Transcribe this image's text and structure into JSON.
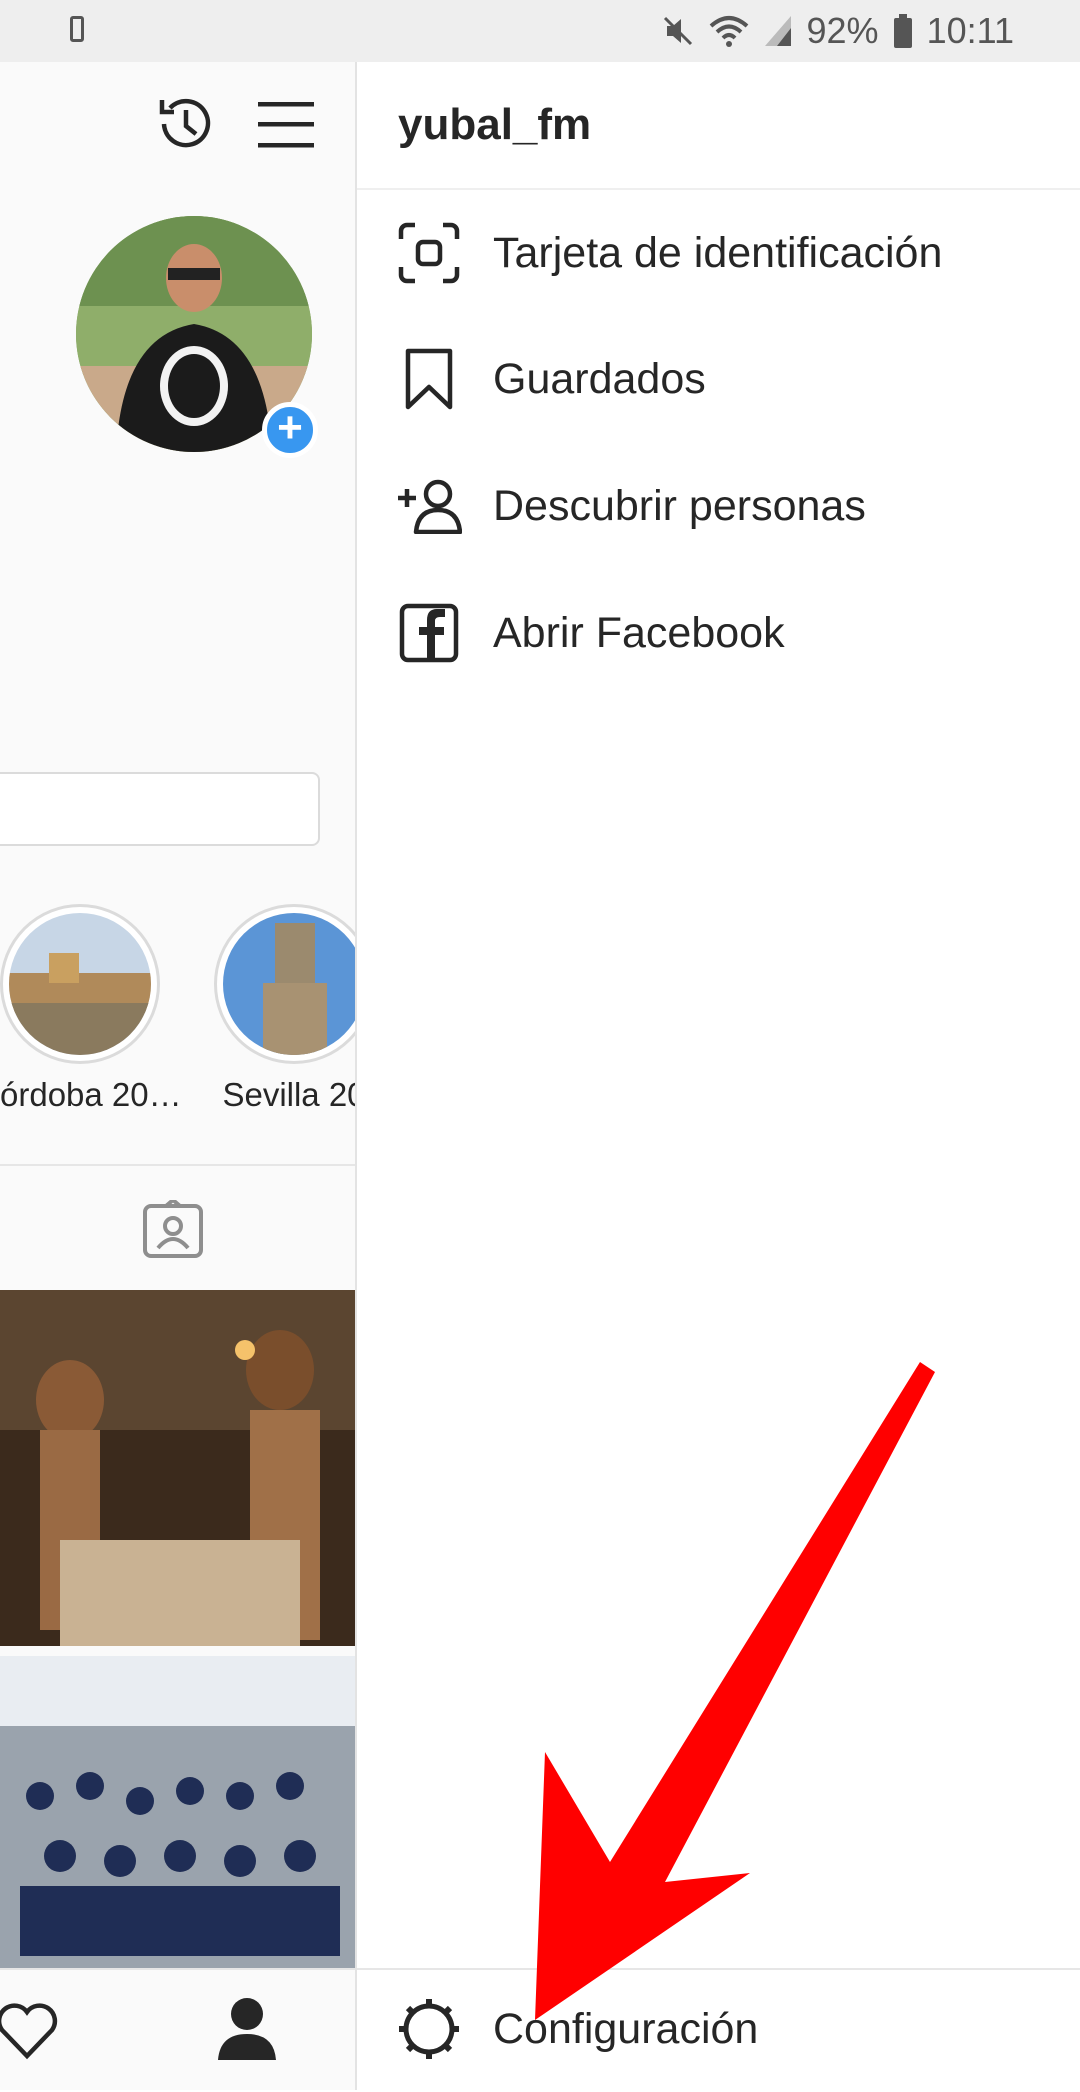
{
  "status_bar": {
    "battery": "92%",
    "time": "10:11",
    "icons": [
      "phone-icon",
      "mute-icon",
      "wifi-icon",
      "signal-icon",
      "battery-icon"
    ]
  },
  "profile_pane": {
    "icons": [
      "history-icon",
      "menu-icon",
      "add-story-icon",
      "tagged-icon",
      "heart-icon",
      "profile-icon"
    ],
    "highlights": [
      {
        "label": "órdoba 20…"
      },
      {
        "label": "Sevilla 20"
      }
    ],
    "add_badge": "+"
  },
  "drawer": {
    "username": "yubal_fm",
    "menu": [
      {
        "icon": "nametag-icon",
        "label": "Tarjeta de identificación"
      },
      {
        "icon": "bookmark-icon",
        "label": "Guardados"
      },
      {
        "icon": "add-person-icon",
        "label": "Descubrir personas"
      },
      {
        "icon": "facebook-icon",
        "label": "Abrir Facebook"
      }
    ],
    "settings": {
      "icon": "gear-icon",
      "label": "Configuración"
    }
  },
  "colors": {
    "accent_blue": "#3897f0",
    "annotation_arrow": "#ff0000",
    "text": "#262626"
  }
}
